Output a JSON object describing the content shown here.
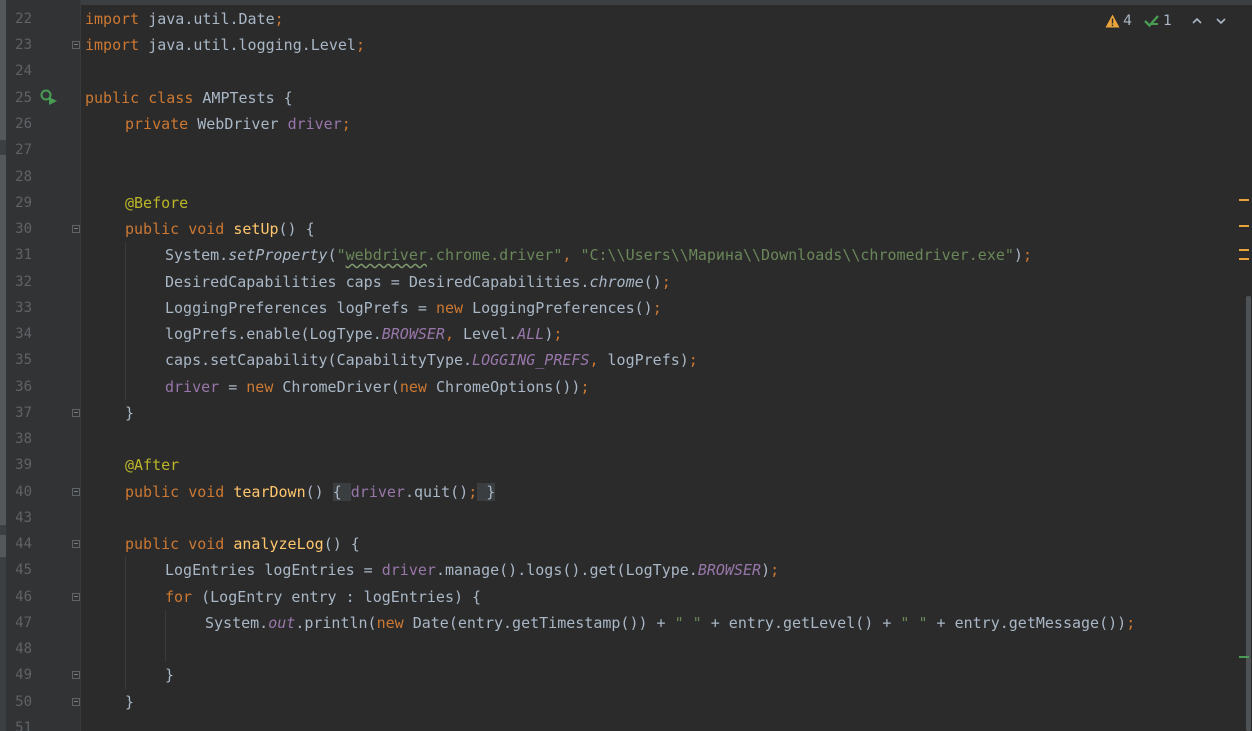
{
  "inspections": {
    "warnings_count": "4",
    "weak_warnings_count": "1"
  },
  "colors": {
    "background": "#2b2b2b",
    "gutter": "#313335",
    "keyword": "#cc7832",
    "field": "#9876aa",
    "method": "#ffc66d",
    "string": "#6a8759",
    "annotation": "#bbb529",
    "default_text": "#a9b7c6",
    "line_number": "#606366",
    "warning_stripe": "#e8a33b",
    "ok_stripe": "#499c54"
  },
  "lines": {
    "l22": {
      "num": "22",
      "t1": "import",
      "t2": " java.util.Date",
      "t3": ";"
    },
    "l23": {
      "num": "23",
      "t1": "import",
      "t2": " java.util.logging.Level",
      "t3": ";"
    },
    "l24": {
      "num": "24"
    },
    "l25": {
      "num": "25",
      "t1": "public class ",
      "t2": "AMPTests {"
    },
    "l26": {
      "num": "26",
      "t1": "private ",
      "t2": "WebDriver ",
      "t3": "driver",
      "t4": ";"
    },
    "l27": {
      "num": "27"
    },
    "l28": {
      "num": "28"
    },
    "l29": {
      "num": "29",
      "t1": "@Before"
    },
    "l30": {
      "num": "30",
      "t1": "public void ",
      "t2": "setUp",
      "t3": "() {"
    },
    "l31": {
      "num": "31",
      "t1": "System.",
      "t2": "setProperty",
      "t3": "(",
      "t4": "\"",
      "t5": "webdriver",
      "t6": ".chrome.driver\"",
      "t7": ", ",
      "t8": "\"C:\\\\Users\\\\Марина\\\\Downloads\\\\chromedriver.exe\"",
      "t9": ")",
      "t10": ";"
    },
    "l32": {
      "num": "32",
      "t1": "DesiredCapabilities caps = DesiredCapabilities.",
      "t2": "chrome",
      "t3": "()",
      "t4": ";"
    },
    "l33": {
      "num": "33",
      "t1": "LoggingPreferences logPrefs = ",
      "t2": "new ",
      "t3": "LoggingPreferences()",
      "t4": ";"
    },
    "l34": {
      "num": "34",
      "t1": "logPrefs.enable(LogType.",
      "t2": "BROWSER",
      "t3": ", ",
      "t4": "Level.",
      "t5": "ALL",
      "t6": ")",
      "t7": ";"
    },
    "l35": {
      "num": "35",
      "t1": "caps.setCapability(CapabilityType.",
      "t2": "LOGGING_PREFS",
      "t3": ", ",
      "t4": "logPrefs)",
      "t5": ";"
    },
    "l36": {
      "num": "36",
      "t1": "driver",
      "t2": " = ",
      "t3": "new ",
      "t4": "ChromeDriver(",
      "t5": "new ",
      "t6": "ChromeOptions())",
      "t7": ";"
    },
    "l37": {
      "num": "37",
      "t1": "}"
    },
    "l38": {
      "num": "38"
    },
    "l39": {
      "num": "39",
      "t1": "@After"
    },
    "l40": {
      "num": "40",
      "t1": "public void ",
      "t2": "tearDown",
      "t3": "() ",
      "t4": "{ ",
      "t5": "driver",
      "t6": ".quit()",
      "t7": ";",
      "t8": " }"
    },
    "l43": {
      "num": "43"
    },
    "l44": {
      "num": "44",
      "t1": "public void ",
      "t2": "analyzeLog",
      "t3": "() {"
    },
    "l45": {
      "num": "45",
      "t1": "LogEntries logEntries = ",
      "t2": "driver",
      "t3": ".manage().logs().get(LogType.",
      "t4": "BROWSER",
      "t5": ")",
      "t6": ";"
    },
    "l46": {
      "num": "46",
      "t1": "for ",
      "t2": "(LogEntry entry : logEntries) {"
    },
    "l47": {
      "num": "47",
      "t1": "System.",
      "t2": "out",
      "t3": ".println(",
      "t4": "new ",
      "t5": "Date(entry.getTimestamp()) + ",
      "t6": "\" \"",
      "t7": " + entry.getLevel() + ",
      "t8": "\" \"",
      "t9": " + entry.getMessage())",
      "t10": ";"
    },
    "l48": {
      "num": "48"
    },
    "l49": {
      "num": "49",
      "t1": "}"
    },
    "l50": {
      "num": "50",
      "t1": "}"
    },
    "l51": {
      "num": "51"
    }
  }
}
